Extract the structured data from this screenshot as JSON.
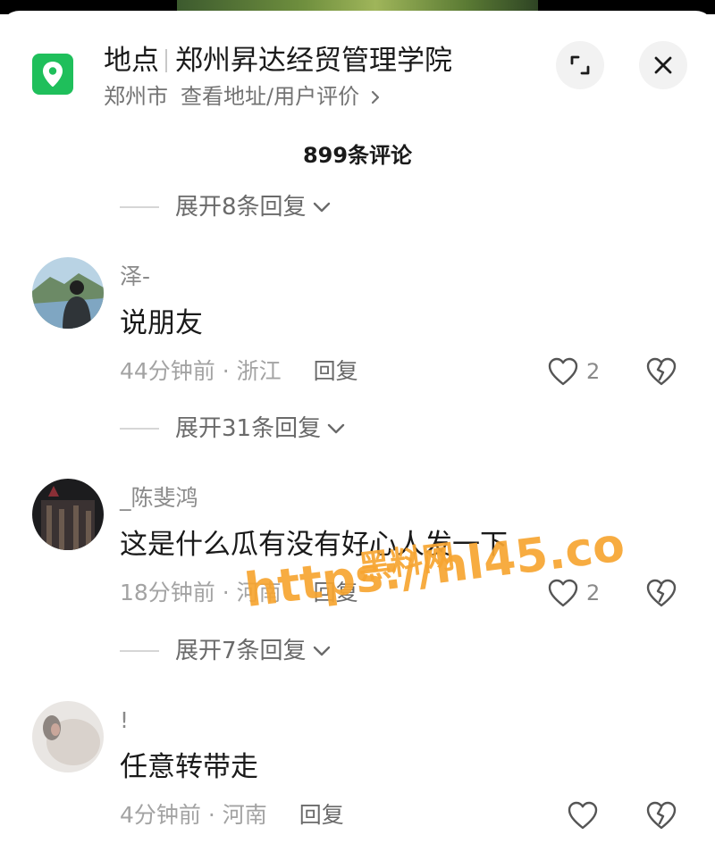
{
  "location": {
    "type_label": "地点",
    "name": "郑州昇达经贸管理学院",
    "city": "郑州市",
    "link": "查看地址/用户评价"
  },
  "comment_count": "899条评论",
  "top_expand": "展开8条回复",
  "comments": [
    {
      "username": "泽-",
      "text": "说朋友",
      "time_place": "44分钟前 · 浙江",
      "reply_label": "回复",
      "likes": "2",
      "expand": "展开31条回复"
    },
    {
      "username": "_陈斐鸿",
      "text": "这是什么瓜有没有好心人发一下",
      "time_place": "18分钟前 · 河南",
      "reply_label": "回复",
      "likes": "2",
      "expand": "展开7条回复"
    },
    {
      "username": "!",
      "text": "任意转带走",
      "time_place": "4分钟前 · 河南",
      "reply_label": "回复",
      "likes": ""
    }
  ],
  "watermark": {
    "line1": "黑料网",
    "line2": "https://hl45.co"
  },
  "colors": {
    "location_icon": "#1fbf5b",
    "watermark": "#f7a531"
  }
}
